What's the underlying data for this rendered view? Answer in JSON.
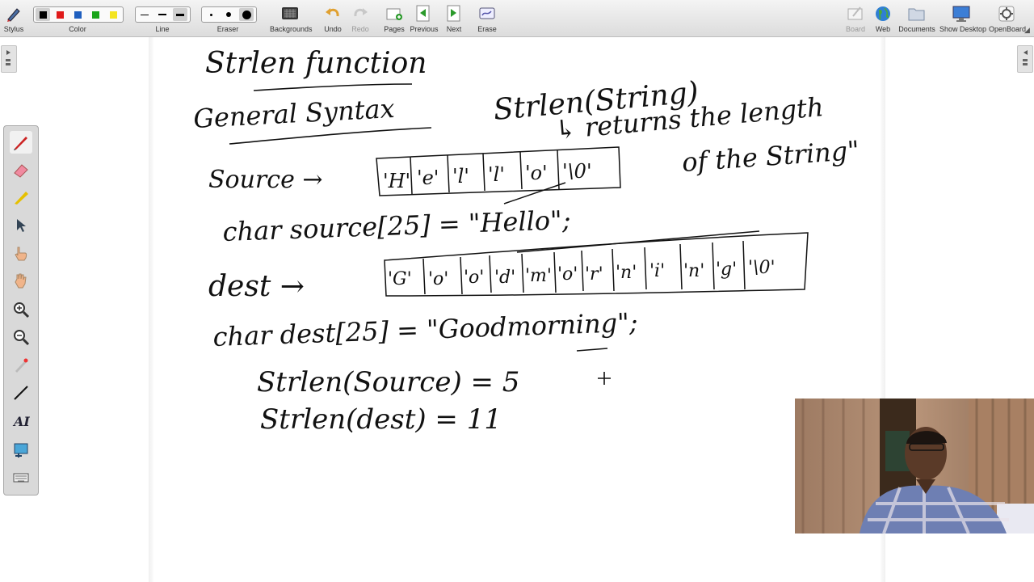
{
  "toolbar": {
    "stylus": "Stylus",
    "color": "Color",
    "line": "Line",
    "eraser": "Eraser",
    "backgrounds": "Backgrounds",
    "undo": "Undo",
    "redo": "Redo",
    "pages": "Pages",
    "previous": "Previous",
    "next": "Next",
    "erase": "Erase",
    "board": "Board",
    "web": "Web",
    "documents": "Documents",
    "show_desktop": "Show Desktop",
    "openboard": "OpenBoard",
    "colors": [
      "#000000",
      "#e01b1b",
      "#1f5fbf",
      "#1aa51a",
      "#f4e420"
    ]
  },
  "board": {
    "title": "Strlen function",
    "syntax_label": "General Syntax",
    "syntax": "Strlen(String)",
    "returns": "↳ returns the length",
    "returns2": "of the String\"",
    "source_label": "Source →",
    "source_cells": [
      "'H'",
      "'e'",
      "'l'",
      "'l'",
      "'o'",
      "'\\0'"
    ],
    "source_decl": "char source[25] = \"Hello\";",
    "dest_label": "dest →",
    "dest_cells": [
      "'G'",
      "'o'",
      "'o'",
      "'d'",
      "'m'",
      "'o'",
      "'r'",
      "'n'",
      "'i'",
      "'n'",
      "'g'",
      "'\\0'"
    ],
    "dest_decl": "char dest[25] = \"Goodmorning\";",
    "res1": "Strlen(Source) = 5",
    "res2": "Strlen(dest) = 11"
  }
}
